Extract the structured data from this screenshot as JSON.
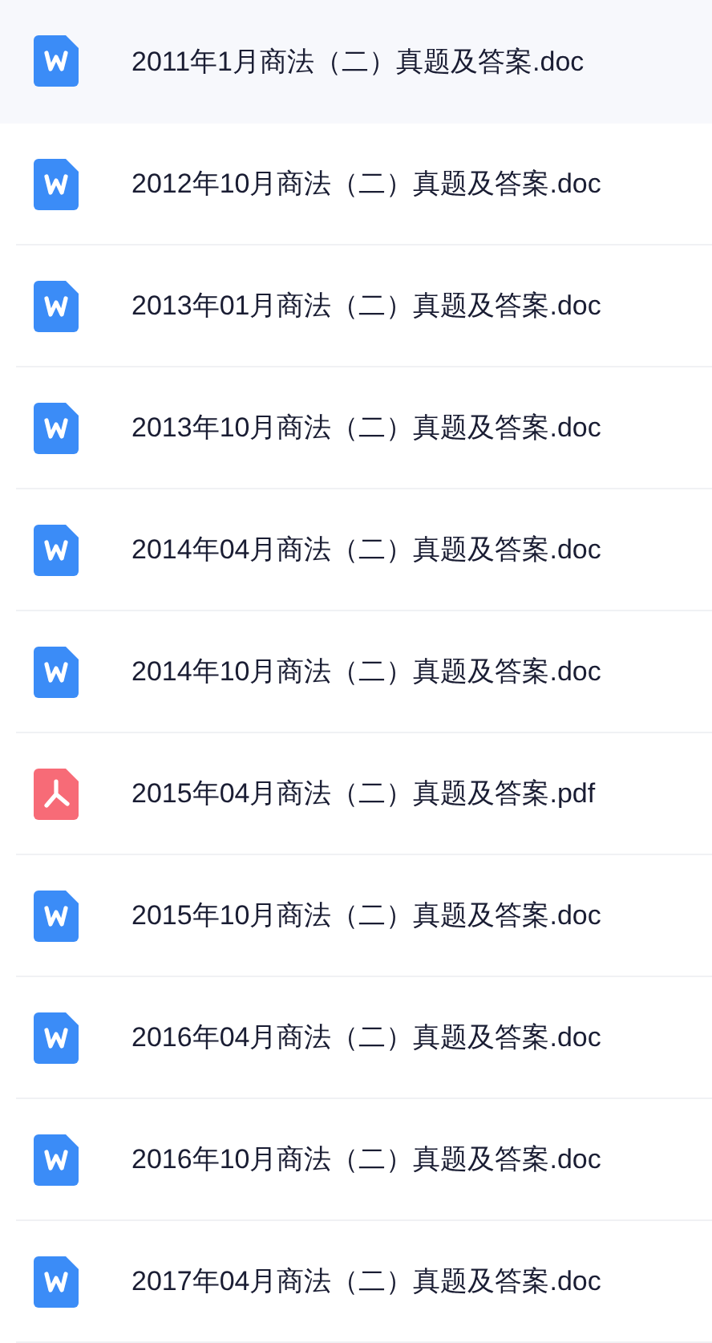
{
  "files": [
    {
      "kind": "doc",
      "name": "2011年1月商法（二）真题及答案.doc",
      "selected": true
    },
    {
      "kind": "doc",
      "name": "2012年10月商法（二）真题及答案.doc",
      "selected": false
    },
    {
      "kind": "doc",
      "name": "2013年01月商法（二）真题及答案.doc",
      "selected": false
    },
    {
      "kind": "doc",
      "name": "2013年10月商法（二）真题及答案.doc",
      "selected": false
    },
    {
      "kind": "doc",
      "name": "2014年04月商法（二）真题及答案.doc",
      "selected": false
    },
    {
      "kind": "doc",
      "name": "2014年10月商法（二）真题及答案.doc",
      "selected": false
    },
    {
      "kind": "pdf",
      "name": "2015年04月商法（二）真题及答案.pdf",
      "selected": false
    },
    {
      "kind": "doc",
      "name": "2015年10月商法（二）真题及答案.doc",
      "selected": false
    },
    {
      "kind": "doc",
      "name": "2016年04月商法（二）真题及答案.doc",
      "selected": false
    },
    {
      "kind": "doc",
      "name": "2016年10月商法（二）真题及答案.doc",
      "selected": false
    },
    {
      "kind": "doc",
      "name": "2017年04月商法（二）真题及答案.doc",
      "selected": false
    }
  ]
}
